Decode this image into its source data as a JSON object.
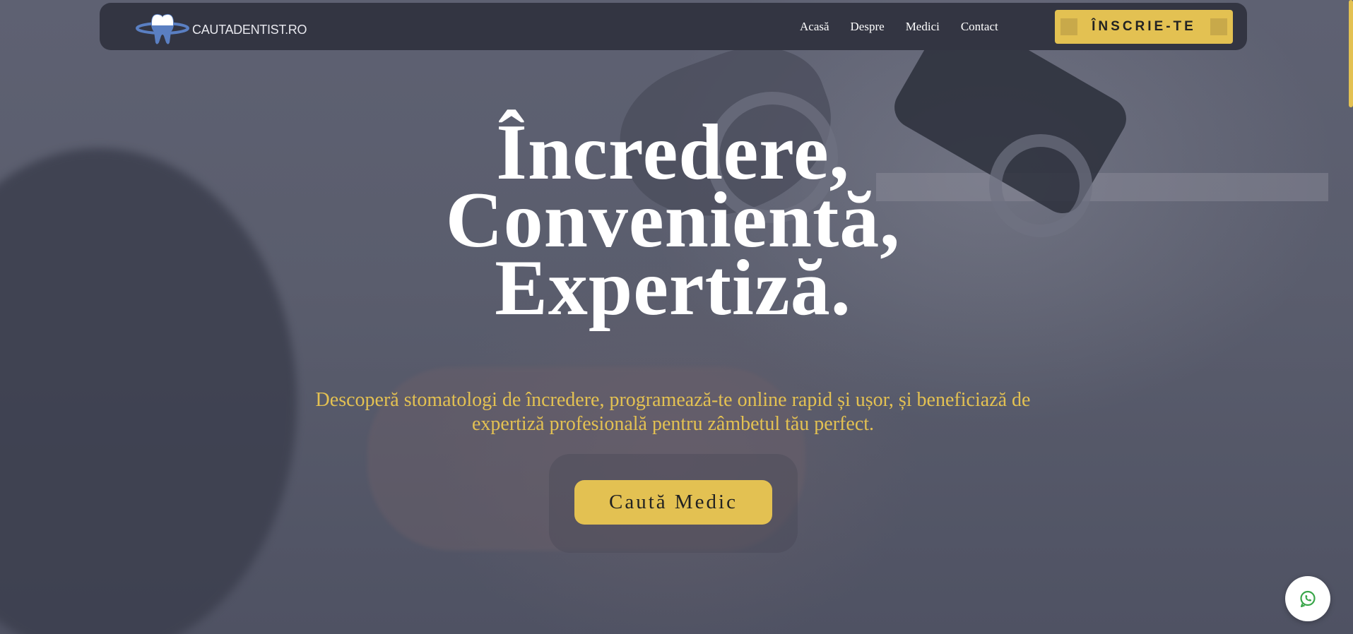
{
  "brand": {
    "logo_text": "CAUTADENTIST.RO",
    "accent_color": "#e3c152",
    "nav_bg": "#333542"
  },
  "nav": {
    "links": [
      {
        "label": "Acasă"
      },
      {
        "label": "Despre"
      },
      {
        "label": "Medici"
      },
      {
        "label": "Contact"
      }
    ],
    "signup_label": "ÎNSCRIE-TE"
  },
  "hero": {
    "title_lines": [
      "Încredere,",
      "Convenientă,",
      "Expertiză."
    ],
    "subtitle_line1": "Descoperă stomatologi de încredere, programează-te online rapid și ușor, și beneficiază de",
    "subtitle_line2": "expertiză profesională pentru zâmbetul tău perfect.",
    "cta_label": "Caută Medic"
  },
  "floating": {
    "whatsapp_icon": "whatsapp-icon"
  },
  "scroll": {
    "position_fraction": 0.0
  }
}
